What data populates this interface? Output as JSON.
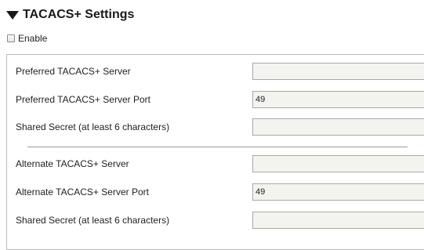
{
  "section": {
    "title": "TACACS+ Settings",
    "toggle_icon": "triangle-down-icon"
  },
  "enable": {
    "label": "Enable",
    "checked": false
  },
  "primary": {
    "server_label": "Preferred TACACS+ Server",
    "server_value": "",
    "port_label": "Preferred TACACS+ Server Port",
    "port_value": "49",
    "secret_label": "Shared Secret (at least 6 characters)",
    "secret_value": ""
  },
  "alternate": {
    "server_label": "Alternate TACACS+ Server",
    "server_value": "",
    "port_label": "Alternate TACACS+ Server Port",
    "port_value": "49",
    "secret_label": "Shared Secret (at least 6 characters)",
    "secret_value": ""
  },
  "colors": {
    "input_background": "#f3f3ef",
    "input_border": "#a9a9a9",
    "panel_border": "#b9b9b9"
  }
}
